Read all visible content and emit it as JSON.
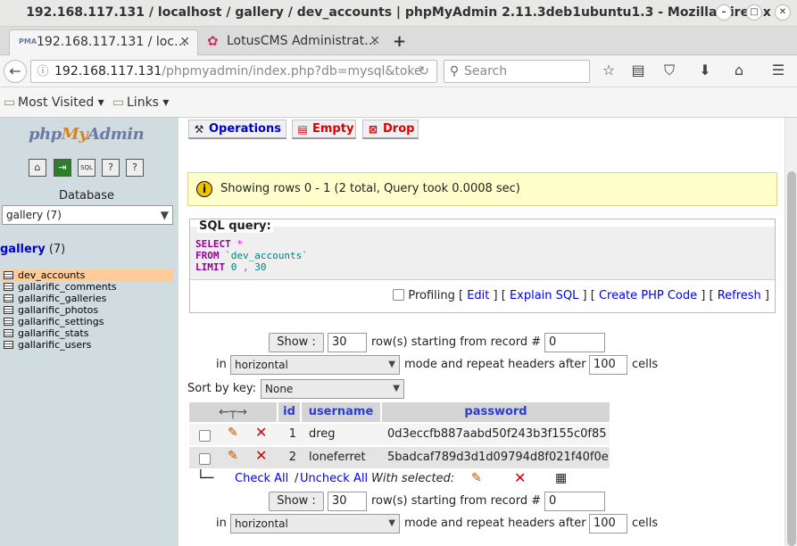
{
  "window": {
    "title": "192.168.117.131 / localhost / gallery / dev_accounts | phpMyAdmin 2.11.3deb1ubuntu1.3 - Mozilla Firefox"
  },
  "tabs": [
    {
      "label": "192.168.117.131 / loc…",
      "favicon": "pma-icon"
    },
    {
      "label": "LotusCMS Administrat…",
      "favicon": "lotus-icon"
    }
  ],
  "nav": {
    "url_host": "192.168.117.131",
    "url_path": "/phpmyadmin/index.php?db=mysql&toke",
    "search_placeholder": "Search"
  },
  "bookmarks": {
    "most_visited": "Most Visited",
    "links": "Links"
  },
  "sidebar": {
    "logo_php": "php",
    "logo_my": "My",
    "logo_admin": "Admin",
    "db_label": "Database",
    "db_select": "gallery (7)",
    "db_name": "gallery",
    "db_count": "(7)",
    "tables": [
      "dev_accounts",
      "gallarific_comments",
      "gallarific_galleries",
      "gallarific_photos",
      "gallarific_settings",
      "gallarific_stats",
      "gallarific_users"
    ]
  },
  "ops": {
    "operations": "Operations",
    "empty": "Empty",
    "drop": "Drop"
  },
  "notice": "Showing rows 0 - 1 (2 total, Query took 0.0008 sec)",
  "sql": {
    "legend": "SQL query:",
    "select": "SELECT",
    "star": "*",
    "from": "FROM",
    "table": "`dev_accounts`",
    "limit": "LIMIT",
    "limit_a": "0",
    "comma": ",",
    "limit_b": "30",
    "profiling": "Profiling",
    "edit": "Edit",
    "explain": "Explain SQL",
    "create_php": "Create PHP Code",
    "refresh": "Refresh"
  },
  "nav_form": {
    "show": "Show :",
    "rows_value": "30",
    "rows_text": "row(s) starting from record #",
    "start_value": "0",
    "in": "in",
    "mode": "horizontal",
    "mode_text": "mode and repeat headers after",
    "headers_value": "100",
    "cells": "cells"
  },
  "sort": {
    "label": "Sort by key:",
    "value": "None"
  },
  "table": {
    "columns": [
      "id",
      "username",
      "password"
    ],
    "rows": [
      {
        "id": "1",
        "username": "dreg",
        "password": "0d3eccfb887aabd50f243b3f155c0f85"
      },
      {
        "id": "2",
        "username": "loneferret",
        "password": "5badcaf789d3d1d09794d8f021f40f0e"
      }
    ]
  },
  "with_selected": {
    "check_all": "Check All",
    "sep": "/",
    "uncheck_all": "Uncheck All",
    "label": "With selected:"
  }
}
